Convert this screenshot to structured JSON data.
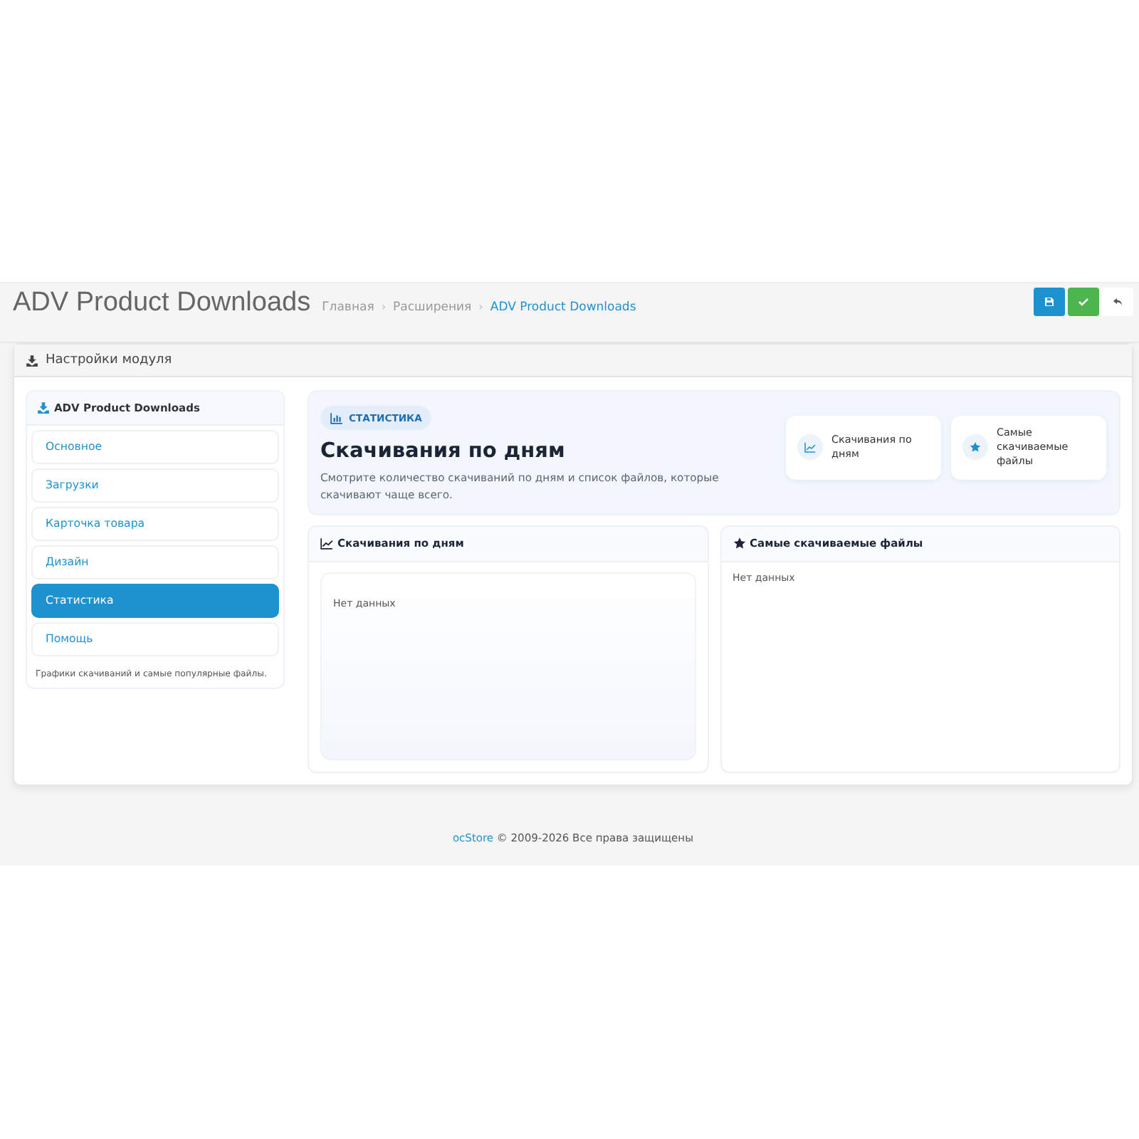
{
  "page": {
    "title": "ADV Product Downloads",
    "separator": "›",
    "breadcrumbs": [
      {
        "label": "Главная",
        "current": false
      },
      {
        "label": "Расширения",
        "current": false
      },
      {
        "label": "ADV Product Downloads",
        "current": true
      }
    ],
    "buttons": [
      {
        "kind": "save"
      },
      {
        "kind": "apply"
      },
      {
        "kind": "back"
      }
    ]
  },
  "panel": {
    "heading": "Настройки модуля"
  },
  "sidebar": {
    "title": "ADV Product Downloads",
    "items": [
      {
        "label": "Основное",
        "selected": false
      },
      {
        "label": "Загрузки",
        "selected": false
      },
      {
        "label": "Карточка товара",
        "selected": false
      },
      {
        "label": "Дизайн",
        "selected": false
      },
      {
        "label": "Статистика",
        "selected": true
      },
      {
        "label": "Помощь",
        "selected": false
      }
    ],
    "note": "Графики скачиваний и самые популярные файлы."
  },
  "hero": {
    "badge": "СТАТИСТИКА",
    "title": "Скачивания по дням",
    "description": "Смотрите количество скачиваний по дням и список файлов, которые скачивают чаще всего.",
    "cards": [
      {
        "kind": "chart",
        "label": "Скачивания по дням"
      },
      {
        "kind": "star",
        "label": "Самые скачиваемые файлы"
      }
    ]
  },
  "sections": [
    {
      "kind": "chart",
      "title": "Скачивания по дням",
      "empty": "Нет данных"
    },
    {
      "kind": "star",
      "title": "Самые скачиваемые файлы",
      "empty": "Нет данных"
    }
  ],
  "footer": {
    "link": "ocStore",
    "text": "© 2009-2026 Все права защищены"
  }
}
